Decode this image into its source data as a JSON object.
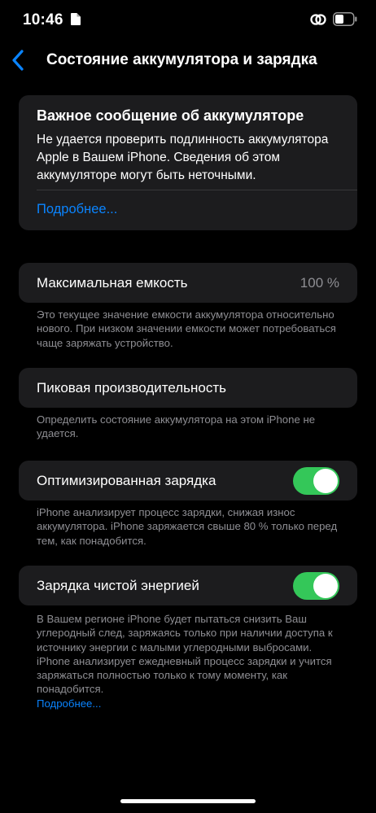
{
  "status_bar": {
    "time": "10:46",
    "icons": [
      "document-icon",
      "link-icon",
      "battery-icon"
    ]
  },
  "nav": {
    "back_icon": "chevron-left-icon",
    "title": "Состояние аккумулятора и зарядка"
  },
  "alert": {
    "title": "Важное сообщение об аккумуляторе",
    "text": "Не удается проверить подлинность аккумулятора Apple в Вашем iPhone. Сведения об этом аккумуляторе могут быть неточными.",
    "link": "Подробнее..."
  },
  "max_capacity": {
    "label": "Максимальная емкость",
    "value": "100 %",
    "footnote": "Это текущее значение емкости аккумулятора относительно нового. При низком значении емкости может потребоваться чаще заряжать устройство."
  },
  "peak_performance": {
    "label": "Пиковая производительность",
    "footnote": "Определить состояние аккумулятора на этом iPhone не удается."
  },
  "optimized_charging": {
    "label": "Оптимизированная зарядка",
    "enabled": true,
    "footnote": "iPhone анализирует процесс зарядки, снижая износ аккумулятора. iPhone заряжается свыше 80 % только перед тем, как понадобится."
  },
  "clean_energy": {
    "label": "Зарядка чистой энергией",
    "enabled": true,
    "footnote": "В Вашем регионе iPhone будет пытаться снизить Ваш углеродный след, заряжаясь только при наличии доступа к источнику энергии с малыми углеродными выбросами. iPhone анализирует ежедневный процесс зарядки и учится заряжаться полностью только к тому моменту, как понадобится.",
    "footnote_link": "Подробнее..."
  },
  "colors": {
    "background": "#000000",
    "card": "#1c1c1e",
    "accent": "#0a84ff",
    "toggle_on": "#34c759",
    "secondary_text": "#8e8e93"
  }
}
